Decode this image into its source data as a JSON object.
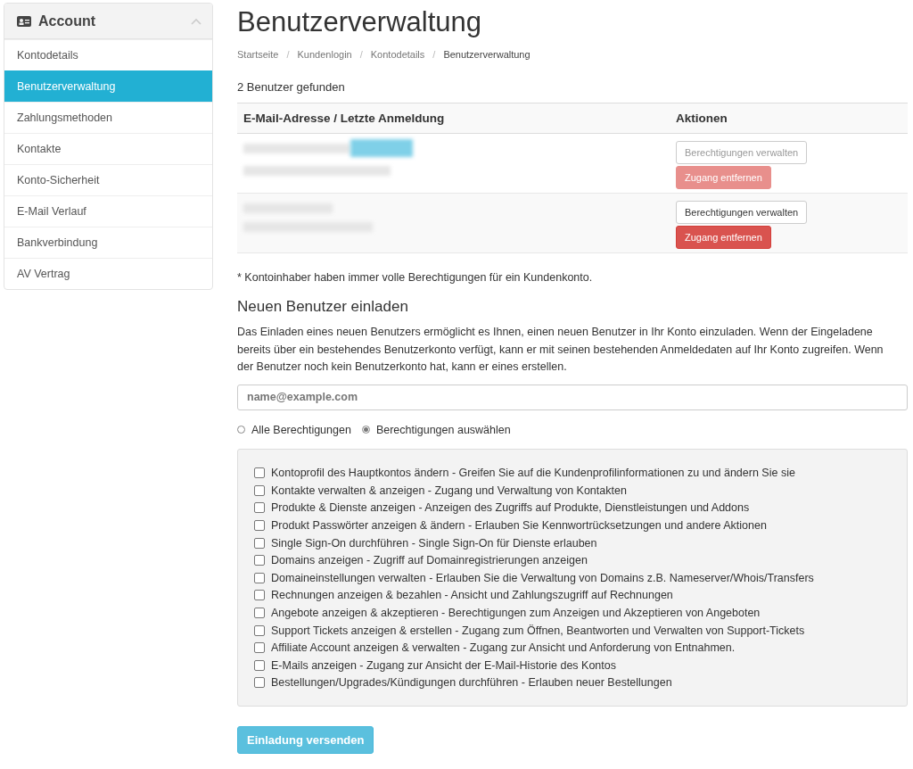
{
  "sidebar": {
    "title": "Account",
    "collapsed": false,
    "items": [
      {
        "label": "Kontodetails",
        "selected": false
      },
      {
        "label": "Benutzerverwaltung",
        "selected": true
      },
      {
        "label": "Zahlungsmethoden",
        "selected": false
      },
      {
        "label": "Kontakte",
        "selected": false
      },
      {
        "label": "Konto-Sicherheit",
        "selected": false
      },
      {
        "label": "E-Mail Verlauf",
        "selected": false
      },
      {
        "label": "Bankverbindung",
        "selected": false
      },
      {
        "label": "AV Vertrag",
        "selected": false
      }
    ]
  },
  "page_title": "Benutzerverwaltung",
  "breadcrumb_separator": "/",
  "breadcrumb": [
    "Startseite",
    "Kundenlogin",
    "Kontodetails",
    "Benutzerverwaltung"
  ],
  "users_found": "2 Benutzer gefunden",
  "table": {
    "columns": [
      "E-Mail-Adresse / Letzte Anmeldung",
      "Aktionen"
    ],
    "rows": [
      {
        "owner": true,
        "manage_button": "Berechtigungen verwalten",
        "remove_button": "Zugang entfernen",
        "disabled": true
      },
      {
        "owner": false,
        "manage_button": "Berechtigungen verwalten",
        "remove_button": "Zugang entfernen",
        "disabled": false
      }
    ]
  },
  "owner_note": "* Kontoinhaber haben immer volle Berechtigungen für ein Kundenkonto.",
  "invite": {
    "heading": "Neuen Benutzer einladen",
    "description": "Das Einladen eines neuen Benutzers ermöglicht es Ihnen, einen neuen Benutzer in Ihr Konto einzuladen. Wenn der Eingeladene bereits über ein bestehendes Benutzerkonto verfügt, kann er mit seinen bestehenden Anmeldedaten auf Ihr Konto zugreifen. Wenn der Benutzer noch kein Benutzerkonto hat, kann er eines erstellen.",
    "email_field": {
      "placeholder": "name@example.com"
    },
    "options": [
      {
        "label": "Alle Berechtigungen",
        "selected": false
      },
      {
        "label": "Berechtigungen auswählen",
        "selected": true
      }
    ],
    "permissions": [
      {
        "label": "Kontoprofil des Hauptkontos ändern - Greifen Sie auf die Kundenprofilinformationen zu und ändern Sie sie",
        "checked": false
      },
      {
        "label": "Kontakte verwalten & anzeigen - Zugang und Verwaltung von Kontakten",
        "checked": false
      },
      {
        "label": "Produkte & Dienste anzeigen - Anzeigen des Zugriffs auf Produkte, Dienstleistungen und Addons",
        "checked": false
      },
      {
        "label": "Produkt Passwörter anzeigen & ändern - Erlauben Sie Kennwortrücksetzungen und andere Aktionen",
        "checked": false
      },
      {
        "label": "Single Sign-On durchführen - Single Sign-On für Dienste erlauben",
        "checked": false
      },
      {
        "label": "Domains anzeigen - Zugriff auf Domainregistrierungen anzeigen",
        "checked": false
      },
      {
        "label": "Domaineinstellungen verwalten - Erlauben Sie die Verwaltung von Domains z.B. Nameserver/Whois/Transfers",
        "checked": false
      },
      {
        "label": "Rechnungen anzeigen & bezahlen - Ansicht und Zahlungszugriff auf Rechnungen",
        "checked": false
      },
      {
        "label": "Angebote anzeigen & akzeptieren - Berechtigungen zum Anzeigen und Akzeptieren von Angeboten",
        "checked": false
      },
      {
        "label": "Support Tickets anzeigen & erstellen - Zugang zum Öffnen, Beantworten und Verwalten von Support-Tickets",
        "checked": false
      },
      {
        "label": "Affiliate Account anzeigen & verwalten - Zugang zur Ansicht und Anforderung von Entnahmen.",
        "checked": false
      },
      {
        "label": "E-Mails anzeigen - Zugang zur Ansicht der E-Mail-Historie des Kontos",
        "checked": false
      },
      {
        "label": "Bestellungen/Upgrades/Kündigungen durchführen - Erlauben neuer Bestellungen",
        "checked": false
      }
    ],
    "send_button": "Einladung versenden"
  }
}
